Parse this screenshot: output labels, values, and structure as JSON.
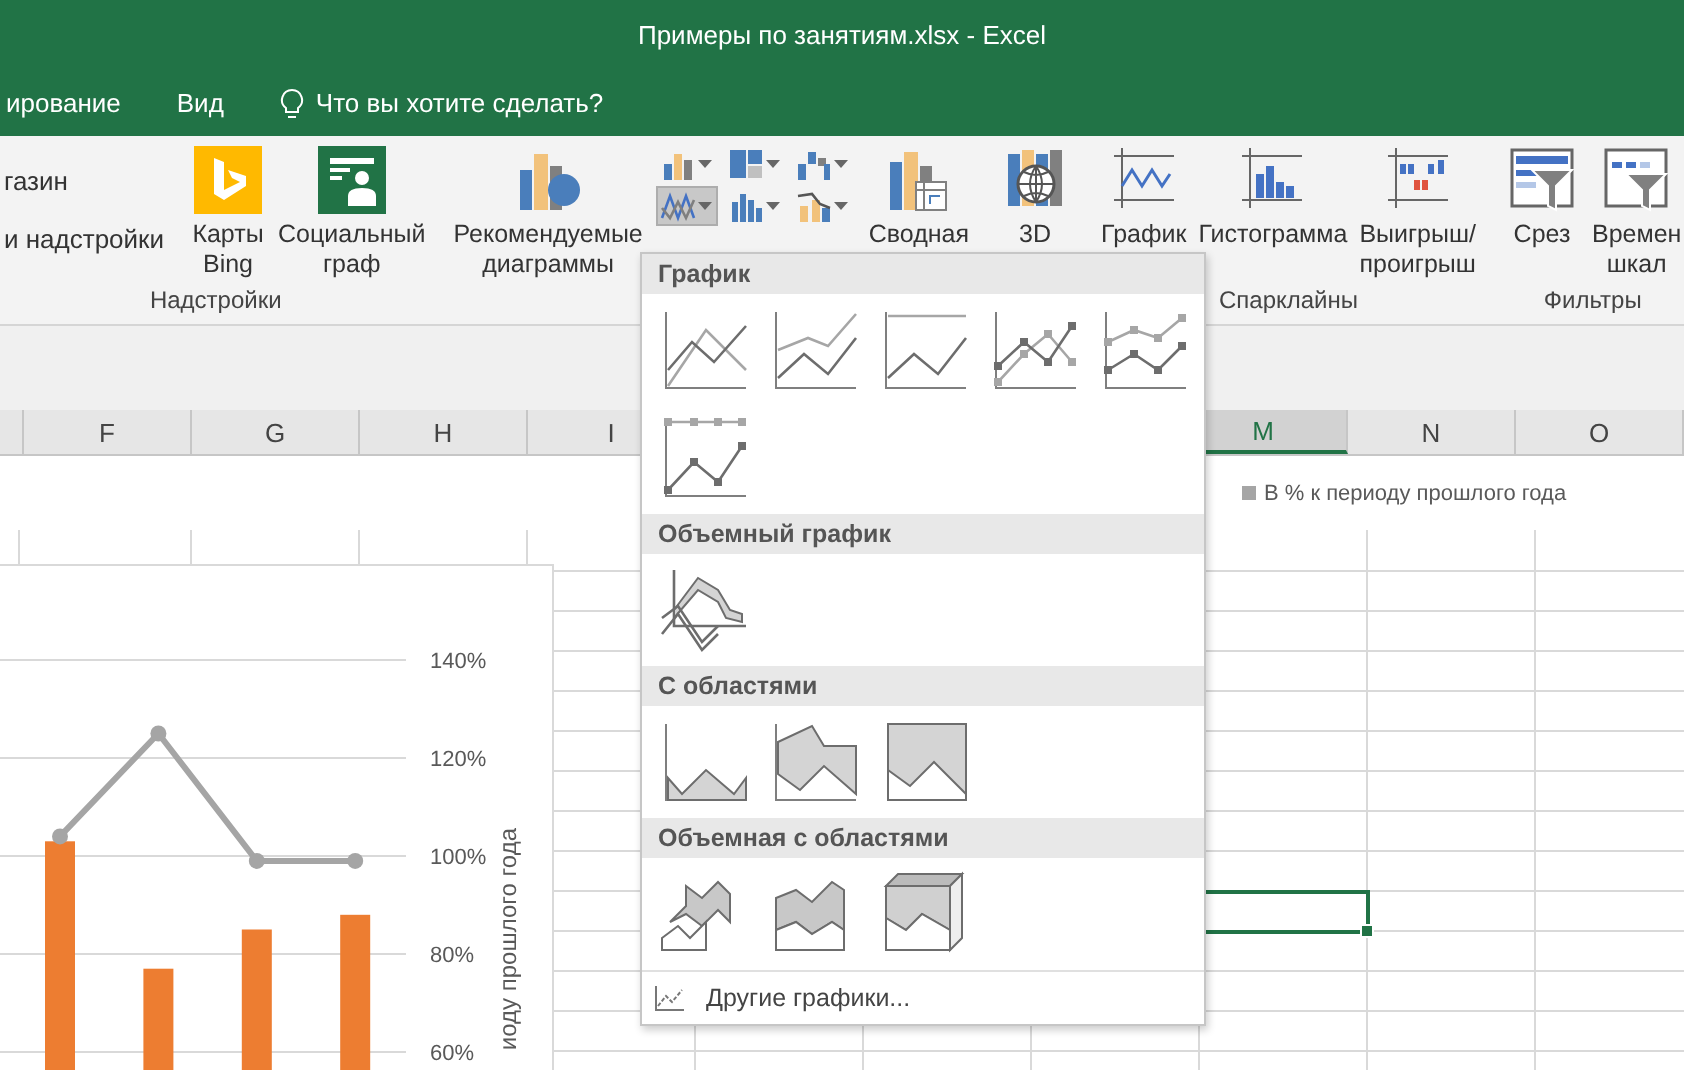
{
  "window": {
    "title": "Примеры по занятиям.xlsx - Excel"
  },
  "ribbon_tabs": [
    {
      "label": "ирование"
    },
    {
      "label": "Вид"
    }
  ],
  "tell_me": {
    "placeholder": "Что вы хотите сделать?"
  },
  "ribbon": {
    "groups": [
      {
        "label": "Надстройки",
        "items": [
          {
            "kind": "stack",
            "links": [
              {
                "kind": "link",
                "label": "газин"
              },
              {
                "kind": "dropdown",
                "label": "и надстройки"
              }
            ]
          },
          {
            "kind": "bing",
            "label": "Карты\nBing"
          },
          {
            "kind": "people",
            "label": "Социальный\nграф"
          }
        ]
      },
      {
        "items": [
          {
            "kind": "recommended",
            "label": "Рекомендуемые\nдиаграммы"
          },
          {
            "kind": "grid",
            "buttons": [
              {
                "kind": "column",
                "expanded": false
              },
              {
                "kind": "hierarchy",
                "expanded": false
              },
              {
                "kind": "waterfall",
                "expanded": false
              },
              {
                "kind": "line",
                "expanded": true
              },
              {
                "kind": "statistic",
                "expanded": false
              },
              {
                "kind": "combo",
                "expanded": false
              }
            ]
          },
          {
            "kind": "pivot",
            "label": "Сводная"
          }
        ]
      },
      {
        "items": [
          {
            "kind": "map3d",
            "label": "3D"
          }
        ]
      },
      {
        "label": "Спарклайны",
        "items": [
          {
            "kind": "spark-line",
            "label": "График"
          },
          {
            "kind": "spark-column",
            "label": "Гистограмма"
          },
          {
            "kind": "winloss",
            "label": "Выигрыш/\nпроигрыш"
          }
        ]
      },
      {
        "label": "Фильтры",
        "items": [
          {
            "kind": "slicer",
            "label": "Срез"
          },
          {
            "kind": "timeline",
            "label": "Времен\nшкал"
          }
        ]
      }
    ]
  },
  "sheet": {
    "column_groups": [
      [
        {
          "label": "F",
          "selected": false
        },
        {
          "label": "G",
          "selected": false
        },
        {
          "label": "H",
          "selected": false
        },
        {
          "label": "I",
          "selected": false
        }
      ],
      [
        {
          "label": "M",
          "selected": true
        },
        {
          "label": "N",
          "selected": false
        },
        {
          "label": "O",
          "selected": false
        }
      ]
    ],
    "chart_data": {
      "type": "bar",
      "grid": true,
      "ylabel": "иоду прошлого года",
      "ylim": [
        60,
        140
      ],
      "yticks": [
        {
          "value": 140,
          "label": "140%"
        },
        {
          "value": 120,
          "label": "120%"
        },
        {
          "value": 100,
          "label": "100%"
        },
        {
          "value": 80,
          "label": "80%"
        },
        {
          "value": 60,
          "label": "60%"
        }
      ],
      "series": [
        {
          "color": "#ed7d31",
          "values": [
            103,
            77,
            85,
            88
          ]
        },
        {
          "type": "line",
          "name": "В % к периоду прошлого года",
          "color": "#a5a5a5",
          "marker": true,
          "values": [
            104,
            125,
            99,
            99
          ]
        }
      ]
    }
  },
  "dropdown": {
    "sections": [
      {
        "title": "График",
        "items": [
          {
            "kind": "line"
          },
          {
            "kind": "stacked-line"
          },
          {
            "kind": "stacked-line-100"
          },
          {
            "kind": "line-markers"
          },
          {
            "kind": "stacked-line-markers"
          },
          {
            "kind": "stacked-line-100-markers"
          }
        ]
      },
      {
        "title": "Объемный график",
        "items": [
          {
            "kind": "line-3d"
          }
        ]
      },
      {
        "title": "С областями",
        "items": [
          {
            "kind": "area"
          },
          {
            "kind": "stacked-area"
          },
          {
            "kind": "area-100"
          }
        ]
      },
      {
        "title": "Объемная с областями",
        "items": [
          {
            "kind": "area-3d"
          },
          {
            "kind": "stacked-area-3d"
          },
          {
            "kind": "area-100-3d"
          }
        ]
      }
    ],
    "footer": "Другие графики..."
  }
}
